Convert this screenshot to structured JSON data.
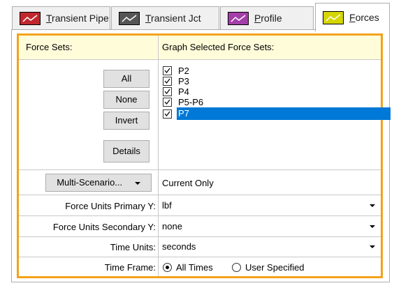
{
  "tabs": [
    {
      "label": "Transient Pipe",
      "mnemonic": "T",
      "rest": "ransient Pipe",
      "icon": "red-graph-icon",
      "color": "#c0272d"
    },
    {
      "label": "Transient Jct",
      "mnemonic": "T",
      "rest": "ransient Jct",
      "icon": "gray-graph-icon",
      "color": "#555555"
    },
    {
      "label": "Profile",
      "mnemonic": "P",
      "rest": "rofile",
      "icon": "purple-graph-icon",
      "color": "#a43ea8"
    },
    {
      "label": "Forces",
      "mnemonic": "F",
      "rest": "orces",
      "icon": "yellow-graph-icon",
      "color": "#d5d500",
      "active": true
    }
  ],
  "header": {
    "force_sets": "Force Sets:",
    "graph_selected": "Graph Selected Force Sets:"
  },
  "buttons": {
    "all": "All",
    "none": "None",
    "invert": "Invert",
    "details": "Details"
  },
  "force_sets": [
    {
      "label": "P2",
      "checked": true,
      "selected": false
    },
    {
      "label": "P3",
      "checked": true,
      "selected": false
    },
    {
      "label": "P4",
      "checked": true,
      "selected": false
    },
    {
      "label": "P5-P6",
      "checked": true,
      "selected": false
    },
    {
      "label": "P7",
      "checked": true,
      "selected": true
    }
  ],
  "multi_scenario": {
    "label": "Multi-Scenario...",
    "value": "Current Only"
  },
  "rows": {
    "primary_y": {
      "label": "Force Units Primary Y:",
      "value": "lbf"
    },
    "secondary_y": {
      "label": "Force Units Secondary Y:",
      "value": "none"
    },
    "time_units": {
      "label": "Time Units:",
      "value": "seconds"
    },
    "time_frame": {
      "label": "Time Frame:",
      "option1": "All Times",
      "option2": "User Specified",
      "selected": "All Times"
    }
  },
  "colors": {
    "accent_border": "#f3a21b",
    "header_bg": "#fffcd9",
    "selection": "#0078d7"
  }
}
